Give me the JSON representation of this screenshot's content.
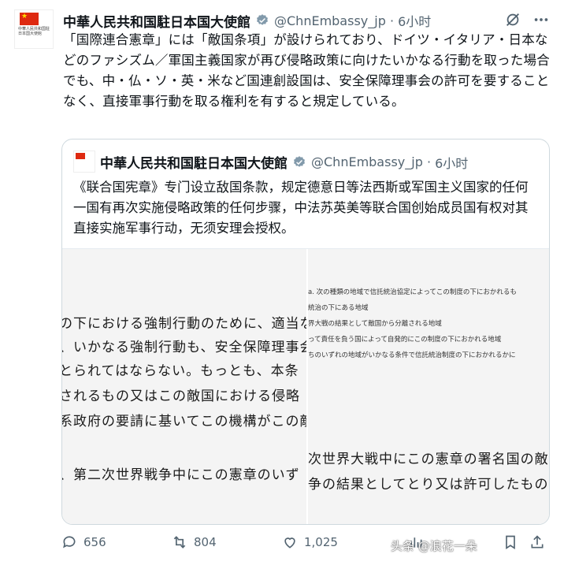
{
  "author": {
    "name": "中華人民共和国駐日本国大使館",
    "handle": "@ChnEmbassy_jp",
    "time": "6小时",
    "avatar_text": "中華人民共和国駐日本国大使館"
  },
  "tweet": {
    "text": "「国際連合憲章」には「敵国条項」が設けられており、ドイツ・イタリア・日本などのファシズム／軍国主義国家が再び侵略政策に向けたいかなる行動を取った場合でも、中・仏・ソ・英・米など国連創設国は、安全保障理事会の許可を要することなく、直接軍事行動を取る権利を有すると規定している。"
  },
  "quote": {
    "name": "中華人民共和国駐日本国大使館",
    "handle": "@ChnEmbassy_jp",
    "time": "6小时",
    "text": "《联合国宪章》专门设立敌国条款，规定德意日等法西斯或军国主义国家的任何一国有再次实施侵略政策的任何步骤，中法苏英美等联合国创始成员国有权对其直接实施军事行动，无须安理会授权。",
    "image_left": {
      "lines": [
        "の下における強制行動のために、適当な",
        "、いかなる強制行動も、安全保障理事会",
        "とられてはならない。もっとも、本条",
        "されるもの又はこの敵国における侵略",
        "系政府の要請に基いてこの機構がこの敵",
        "、第二次世界戦争中にこの憲章のいず"
      ]
    },
    "image_right": {
      "small_lines": [
        "a. 次の種類の地域で信託統治協定によってこの制度の下におかれるも",
        "統治の下にある地域",
        "界大戦の結果として敵国から分離される地域",
        "って責任を負う国によって自発的にこの制度の下におかれる地域",
        "ちのいずれの地域がいかなる条件で信託統治制度の下におかれるかに"
      ],
      "big_lines": [
        "次世界大戦中にこの憲章の署名国の敵であ",
        "争の結果としてとり又は許可したものを無"
      ]
    }
  },
  "actions": {
    "replies": "656",
    "retweets": "804",
    "likes": "1,025"
  },
  "watermark": "头条 @浪花一朵"
}
